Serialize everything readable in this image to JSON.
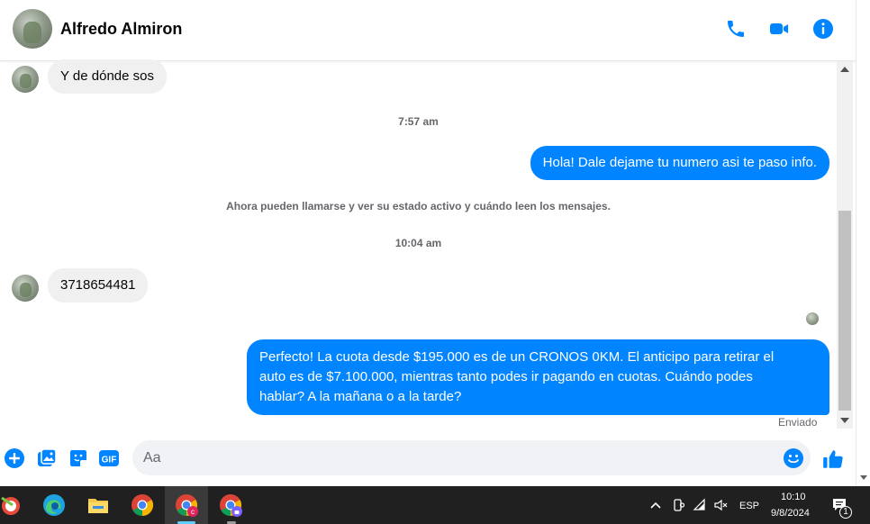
{
  "header": {
    "contact_name": "Alfredo Almiron",
    "icons": [
      "phone-icon",
      "video-camera-icon",
      "info-icon"
    ],
    "accent_color": "#0084ff"
  },
  "messages": [
    {
      "type": "incoming",
      "text": "Y de dónde sos"
    },
    {
      "type": "timestamp",
      "text": "7:57 am"
    },
    {
      "type": "outgoing",
      "text": "Hola! Dale dejame tu numero  asi te paso info."
    },
    {
      "type": "system",
      "text": "Ahora pueden llamarse y ver su estado activo y cuándo leen los mensajes."
    },
    {
      "type": "timestamp",
      "text": "10:04 am"
    },
    {
      "type": "incoming",
      "text": "3718654481"
    },
    {
      "type": "outgoing",
      "lines": [
        "Perfecto! La cuota desde $195.000 es de un CRONOS 0KM. El anticipo para retirar el",
        "auto es de $7.100.000, mientras tanto podes ir pagando en cuotas. Cuándo podes",
        "hablar? A la mañana o a la tarde?"
      ]
    }
  ],
  "status": {
    "sent_label": "Enviado"
  },
  "composer": {
    "placeholder": "Aa",
    "icons": [
      "plus-icon",
      "image-icon",
      "sticker-icon",
      "gif-icon",
      "emoji-icon",
      "thumbs-up-icon"
    ],
    "gif_label": "GIF"
  },
  "taskbar": {
    "apps": [
      "start-icon",
      "edge-icon",
      "file-explorer-icon",
      "chrome-icon",
      "chrome-profile-c-icon",
      "chrome-profile-lock-icon"
    ],
    "language": "ESP",
    "time": "10:10",
    "date": "9/8/2024",
    "notification_count": "1"
  }
}
